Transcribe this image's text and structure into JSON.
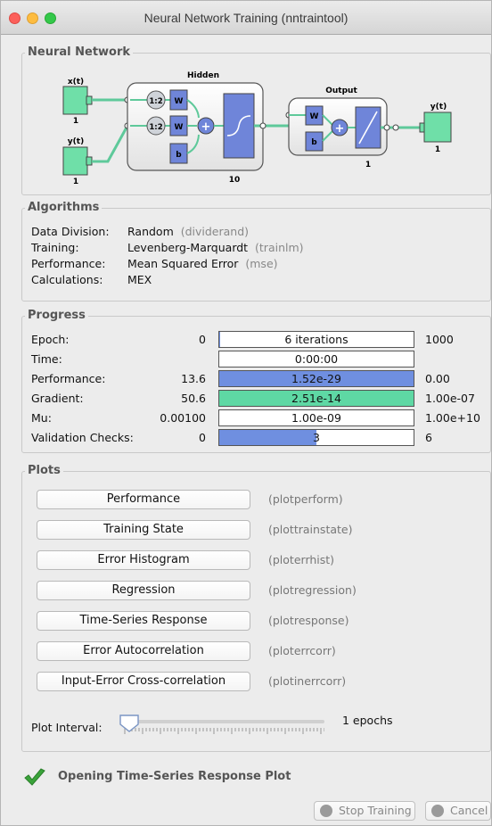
{
  "window": {
    "title": "Neural Network Training (nntraintool)"
  },
  "network": {
    "section_title": "Neural Network",
    "input1_label": "x(t)",
    "input1_size": "1",
    "input2_label": "y(t)",
    "input2_size": "1",
    "hidden_label": "Hidden",
    "hidden_size": "10",
    "output_label": "Output",
    "output_size": "1",
    "y_output_label": "y(t)",
    "y_output_size": "1",
    "delay_label": "1:2",
    "weight_label": "W",
    "bias_label": "b",
    "sum_symbol": "+"
  },
  "algorithms": {
    "section_title": "Algorithms",
    "rows": [
      {
        "label": "Data Division:",
        "value": "Random",
        "fn": "(dividerand)"
      },
      {
        "label": "Training:",
        "value": "Levenberg-Marquardt",
        "fn": "(trainlm)"
      },
      {
        "label": "Performance:",
        "value": "Mean Squared Error",
        "fn": "(mse)"
      },
      {
        "label": "Calculations:",
        "value": "MEX",
        "fn": ""
      }
    ]
  },
  "progress": {
    "section_title": "Progress",
    "rows": [
      {
        "label": "Epoch:",
        "start": "0",
        "value": "6 iterations",
        "end": "1000",
        "fill_fraction": 0.006,
        "fill_color": "#6f8fe0"
      },
      {
        "label": "Time:",
        "start": "",
        "value": "0:00:00",
        "end": "",
        "fill_fraction": 0,
        "fill_color": "#6f8fe0"
      },
      {
        "label": "Performance:",
        "start": "13.6",
        "value": "1.52e-29",
        "end": "0.00",
        "fill_fraction": 1,
        "fill_color": "#6f8fe0"
      },
      {
        "label": "Gradient:",
        "start": "50.6",
        "value": "2.51e-14",
        "end": "1.00e-07",
        "fill_fraction": 1,
        "fill_color": "#5ed8a4"
      },
      {
        "label": "Mu:",
        "start": "0.00100",
        "value": "1.00e-09",
        "end": "1.00e+10",
        "fill_fraction": 0,
        "fill_color": "#6f8fe0"
      },
      {
        "label": "Validation Checks:",
        "start": "0",
        "value": "3",
        "end": "6",
        "fill_fraction": 0.5,
        "fill_color": "#6f8fe0"
      }
    ]
  },
  "plots": {
    "section_title": "Plots",
    "buttons": [
      {
        "label": "Performance",
        "fn": "(plotperform)"
      },
      {
        "label": "Training State",
        "fn": "(plottrainstate)"
      },
      {
        "label": "Error Histogram",
        "fn": "(ploterrhist)"
      },
      {
        "label": "Regression",
        "fn": "(plotregression)"
      },
      {
        "label": "Time-Series Response",
        "fn": "(plotresponse)"
      },
      {
        "label": "Error Autocorrelation",
        "fn": "(ploterrcorr)"
      },
      {
        "label": "Input-Error Cross-correlation",
        "fn": "(plotinerrcorr)"
      }
    ],
    "interval_label": "Plot Interval:",
    "interval_value": "1 epochs",
    "interval_fraction": 0
  },
  "status": {
    "message": "Opening Time-Series Response Plot",
    "icon": "check-icon",
    "icon_color": "#3aa33a"
  },
  "footer": {
    "stop_label": "Stop Training",
    "cancel_label": "Cancel"
  }
}
